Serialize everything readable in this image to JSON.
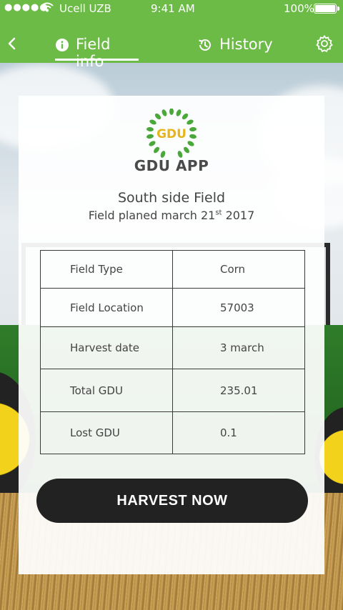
{
  "status_bar": {
    "signal": "●●●●●",
    "carrier": "Ucell UZB",
    "time": "9:41 AM",
    "battery": "100%"
  },
  "nav": {
    "back_icon": "chevron-left-icon",
    "tabs": [
      {
        "label": "Field info",
        "icon": "info-icon",
        "active": true
      },
      {
        "label": "History",
        "icon": "history-icon",
        "active": false
      }
    ],
    "settings_icon": "gear-icon"
  },
  "logo": {
    "text": "GDU",
    "app_name": "GDU APP"
  },
  "field": {
    "name": "South side Field",
    "planned_prefix": "Field planed march 21",
    "planned_sup": "st",
    "planned_suffix": " 2017"
  },
  "details": [
    {
      "key": "Field Type",
      "value": "Corn"
    },
    {
      "key": "Field Location",
      "value": "57003"
    },
    {
      "key": "Harvest date",
      "value": "3 march"
    },
    {
      "key": "Total GDU",
      "value": "235.01"
    },
    {
      "key": "Lost GDU",
      "value": "0.1"
    }
  ],
  "actions": {
    "harvest_label": "HARVEST NOW"
  },
  "colors": {
    "header": "#6cbb47",
    "button": "#222222",
    "logo_green": "#4aa83a",
    "logo_yellow": "#e6b51a"
  }
}
